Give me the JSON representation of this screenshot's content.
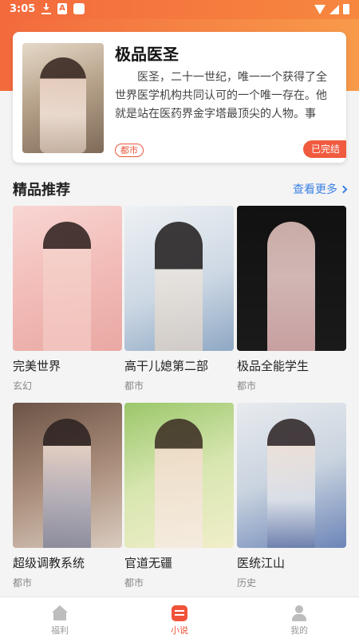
{
  "status_bar": {
    "time": "3:05"
  },
  "featured": {
    "title": "极品医圣",
    "description": "医圣，二十一世纪，唯一一个获得了全世界医学机构共同认可的一个唯一存在。他就是站在医药界金字塔最顶尖的人物。事实...",
    "category_tag": "都市",
    "status": "已完结"
  },
  "section": {
    "title": "精品推荐",
    "see_more": "查看更多"
  },
  "books": [
    {
      "name": "完美世界",
      "category": "玄幻"
    },
    {
      "name": "高干儿媳第二部",
      "category": "都市"
    },
    {
      "name": "极品全能学生",
      "category": "都市"
    },
    {
      "name": "超级调教系统",
      "category": "都市"
    },
    {
      "name": "官道无疆",
      "category": "都市"
    },
    {
      "name": "医统江山",
      "category": "历史"
    }
  ],
  "bottom_nav": [
    {
      "label": "福利",
      "icon": "home-icon",
      "active": false
    },
    {
      "label": "小说",
      "icon": "novel-icon",
      "active": true
    },
    {
      "label": "我的",
      "icon": "user-icon",
      "active": false
    }
  ],
  "colors": {
    "accent": "#f0533a",
    "link": "#3b82e6",
    "header_start": "#f36a3d",
    "header_end": "#f89a4a"
  }
}
